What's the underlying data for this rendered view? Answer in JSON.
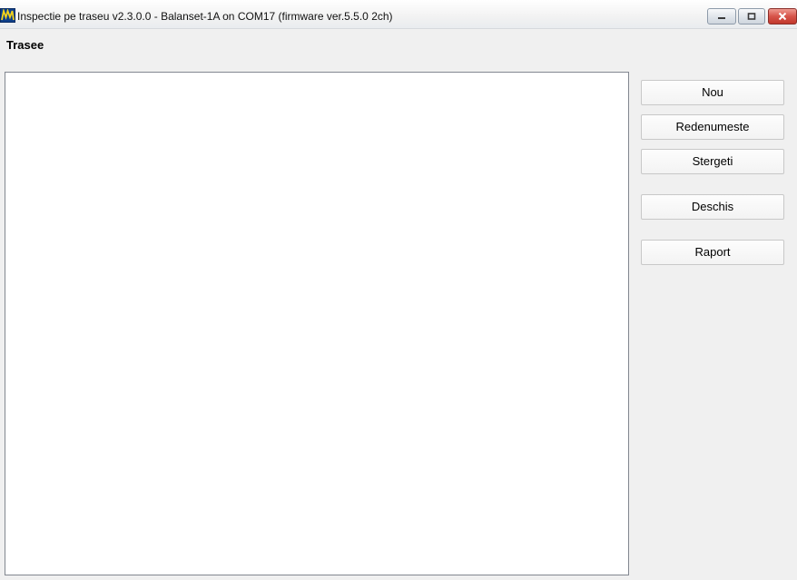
{
  "window": {
    "title": "Inspectie pe traseu v2.3.0.0 - Balanset-1A on COM17 (firmware ver.5.5.0 2ch)",
    "icon": "balanset-app-icon",
    "controls": [
      "minimize-icon",
      "maximize-icon",
      "close-icon"
    ]
  },
  "main": {
    "section_title": "Trasee",
    "routes_list": []
  },
  "actions": {
    "new_label": "Nou",
    "rename_label": "Redenumeste",
    "delete_label": "Stergeti",
    "open_label": "Deschis",
    "report_label": "Raport"
  },
  "colors": {
    "background": "#f0f0f0",
    "list_background": "#ffffff",
    "close_button": "#c1382d"
  }
}
